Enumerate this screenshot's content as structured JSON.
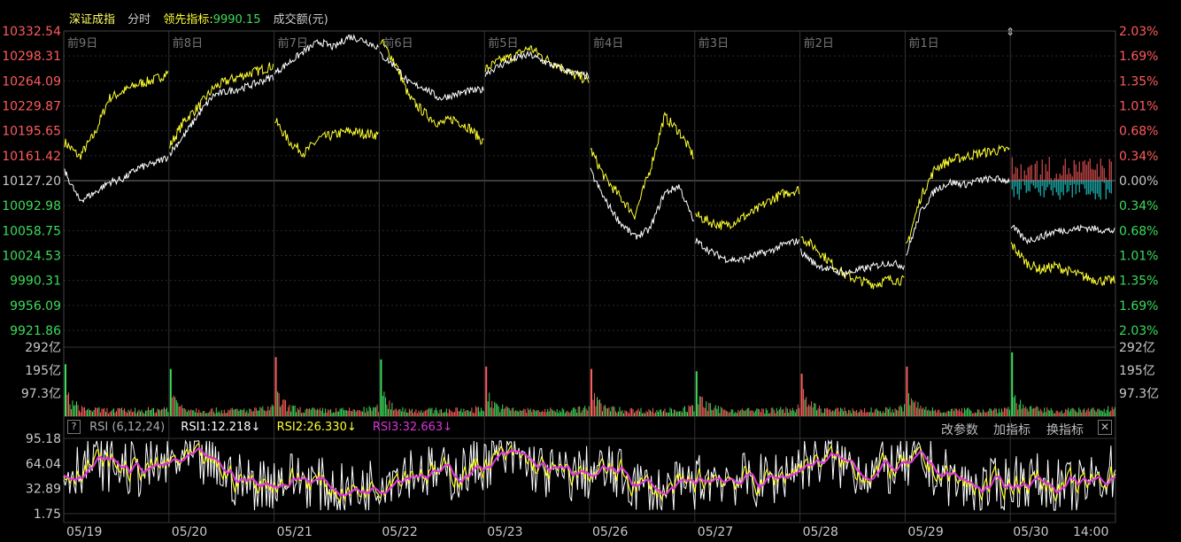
{
  "header": {
    "index_name": "深证成指",
    "period": "分时",
    "leading_label": "领先指标:",
    "leading_value": "9990.15",
    "volume_label": "成交额(元)"
  },
  "rsi_panel": {
    "help": "?",
    "name": "RSI (6,12,24)",
    "rsi1": "RSI1:12.218↓",
    "rsi2": "RSI2:26.330↓",
    "rsi3": "RSI3:32.663↓",
    "btn_params": "改参数",
    "btn_add": "加指标",
    "btn_switch": "换指标",
    "btn_close": "✕"
  },
  "colors": {
    "up": "#ff5b5b",
    "down": "#3cdc5a",
    "neutral": "#c8c8c8",
    "price": "#ffffff",
    "leading": "#ffff33",
    "rsi1": "#ffffff",
    "rsi2": "#ffff33",
    "rsi3": "#dd33dd",
    "cyan": "#22dddd",
    "grid": "#2a2a2a"
  },
  "chart_data": {
    "type": "line",
    "price": {
      "y_ticks": [
        "10332.54",
        "10298.31",
        "10264.09",
        "10229.87",
        "10195.65",
        "10161.42",
        "10127.20",
        "10092.98",
        "10058.75",
        "10024.53",
        "9990.31",
        "9956.09",
        "9921.86"
      ],
      "pct_ticks": [
        "2.03%",
        "1.69%",
        "1.35%",
        "1.01%",
        "0.68%",
        "0.34%",
        "0.00%",
        "0.34%",
        "0.68%",
        "1.01%",
        "1.35%",
        "1.69%",
        "2.03%"
      ],
      "ylim": [
        9921.86,
        10332.54
      ],
      "baseline": 10127.2,
      "day_labels": [
        "前9日",
        "前8日",
        "前7日",
        "前6日",
        "前5日",
        "前4日",
        "前3日",
        "前2日",
        "前1日"
      ],
      "days": [
        {
          "price": [
            10140,
            10100,
            10110,
            10125,
            10130,
            10145,
            10150,
            10160
          ],
          "leading": [
            10180,
            10160,
            10190,
            10240,
            10250,
            10260,
            10265,
            10275
          ]
        },
        {
          "price": [
            10165,
            10190,
            10220,
            10245,
            10250,
            10255,
            10262,
            10270
          ],
          "leading": [
            10175,
            10210,
            10230,
            10255,
            10265,
            10272,
            10278,
            10285
          ]
        },
        {
          "price": [
            10275,
            10290,
            10305,
            10318,
            10310,
            10325,
            10320,
            10310
          ],
          "leading": [
            10210,
            10180,
            10165,
            10185,
            10190,
            10195,
            10192,
            10190
          ]
        },
        {
          "price": [
            10300,
            10285,
            10260,
            10255,
            10240,
            10245,
            10250,
            10252
          ],
          "leading": [
            10320,
            10290,
            10240,
            10220,
            10205,
            10212,
            10200,
            10180
          ]
        },
        {
          "price": [
            10275,
            10285,
            10295,
            10300,
            10290,
            10282,
            10275,
            10270
          ],
          "leading": [
            10280,
            10292,
            10298,
            10310,
            10295,
            10285,
            10272,
            10265
          ]
        },
        {
          "price": [
            10140,
            10100,
            10070,
            10050,
            10060,
            10110,
            10120,
            10070
          ],
          "leading": [
            10170,
            10130,
            10105,
            10080,
            10140,
            10215,
            10195,
            10160
          ]
        },
        {
          "price": [
            10045,
            10030,
            10020,
            10018,
            10025,
            10030,
            10040,
            10045
          ],
          "leading": [
            10080,
            10070,
            10065,
            10075,
            10085,
            10100,
            10110,
            10115
          ]
        },
        {
          "price": [
            10030,
            10012,
            10005,
            10000,
            10005,
            10010,
            10015,
            10010
          ],
          "leading": [
            10050,
            10035,
            10015,
            9998,
            9990,
            9985,
            9992,
            9990
          ]
        },
        {
          "price": [
            10025,
            10085,
            10115,
            10125,
            10122,
            10128,
            10130,
            10127
          ],
          "leading": [
            10035,
            10105,
            10145,
            10155,
            10160,
            10165,
            10168,
            10170
          ]
        },
        {
          "price": [
            10065,
            10045,
            10050,
            10058,
            10060,
            10063,
            10060,
            10058
          ],
          "leading": [
            10040,
            10015,
            10005,
            10010,
            10002,
            9995,
            9990,
            9990
          ]
        }
      ],
      "last_day_bars": {
        "up_max": 0.2,
        "down_max": 0.16
      }
    },
    "volume": {
      "y_ticks": [
        "292亿",
        "195亿",
        "97.3亿"
      ],
      "ylim": [
        0,
        292
      ],
      "open_spikes": [
        220,
        200,
        250,
        240,
        210,
        200,
        190,
        180,
        210,
        270
      ],
      "open_spike_colors": [
        "down",
        "down",
        "up",
        "down",
        "up",
        "up",
        "down",
        "up",
        "up",
        "down"
      ],
      "base_level": 28
    },
    "rsi": {
      "y_ticks": [
        "95.18",
        "64.04",
        "32.89",
        "1.75"
      ],
      "ylim": [
        1.75,
        95.18
      ],
      "center": 50
    },
    "x_labels": [
      "05/19",
      "05/20",
      "05/21",
      "05/22",
      "05/23",
      "05/26",
      "05/27",
      "05/28",
      "05/29",
      "05/30",
      "14:00"
    ]
  }
}
